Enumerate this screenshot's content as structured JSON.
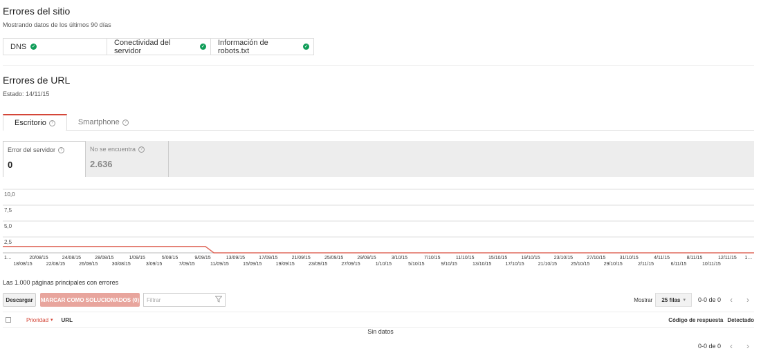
{
  "site_errors": {
    "title": "Errores del sitio",
    "subtitle": "Mostrando datos de los últimos 90 días",
    "checks": [
      {
        "label": "DNS"
      },
      {
        "label": "Conectividad del servidor"
      },
      {
        "label": "Información de robots.txt"
      }
    ],
    "check_color": "#0f9d58"
  },
  "url_errors": {
    "title": "Errores de URL",
    "status": "Estado: 14/11/15",
    "tabs": [
      {
        "label": "Escritorio"
      },
      {
        "label": "Smartphone"
      }
    ],
    "metrics": [
      {
        "label": "Error del servidor",
        "value": "0"
      },
      {
        "label": "No se encuentra",
        "value": "2.636"
      }
    ]
  },
  "chart_data": {
    "type": "line",
    "series_color": "#e06c5f",
    "ylim": [
      0,
      10
    ],
    "y_ticks": [
      "10,0",
      "7,5",
      "5,0",
      "2,5"
    ],
    "x_labels_top": [
      "1…",
      "20/08/15",
      "24/08/15",
      "28/08/15",
      "1/09/15",
      "5/09/15",
      "9/09/15",
      "13/09/15",
      "17/09/15",
      "21/09/15",
      "25/09/15",
      "29/09/15",
      "3/10/15",
      "7/10/15",
      "11/10/15",
      "15/10/15",
      "19/10/15",
      "23/10/15",
      "27/10/15",
      "31/10/15",
      "4/11/15",
      "8/11/15",
      "12/11/15",
      "1…"
    ],
    "x_labels_bottom": [
      "18/08/15",
      "22/08/15",
      "26/08/15",
      "30/08/15",
      "3/09/15",
      "7/09/15",
      "11/09/15",
      "15/09/15",
      "19/09/15",
      "23/09/15",
      "27/09/15",
      "1/10/15",
      "5/10/15",
      "9/10/15",
      "13/10/15",
      "17/10/15",
      "21/10/15",
      "25/10/15",
      "29/10/15",
      "2/11/15",
      "6/11/15",
      "10/11/15"
    ],
    "series": [
      {
        "values": [
          1,
          1,
          1,
          1,
          1,
          1,
          1,
          1,
          1,
          1,
          1,
          1,
          1,
          1,
          1,
          1,
          1,
          1,
          1,
          1,
          1,
          1,
          1,
          1,
          1,
          0,
          0,
          0,
          0,
          0,
          0,
          0,
          0,
          0,
          0,
          0,
          0,
          0,
          0,
          0,
          0,
          0,
          0,
          0,
          0,
          0,
          0,
          0,
          0,
          0,
          0,
          0,
          0,
          0,
          0,
          0,
          0,
          0,
          0,
          0,
          0,
          0,
          0,
          0,
          0,
          0,
          0,
          0,
          0,
          0,
          0,
          0,
          0,
          0,
          0,
          0,
          0,
          0,
          0,
          0,
          0,
          0,
          0,
          0,
          0,
          0,
          0,
          0,
          0,
          0
        ]
      }
    ]
  },
  "table": {
    "title": "Las 1.000 páginas principales con errores",
    "download_label": "Descargar",
    "mark_label": "MARCAR COMO SOLUCIONADOS (0)",
    "filter_placeholder": "Filtrar",
    "show_label": "Mostrar",
    "rows_option": "25 filas",
    "pagination": "0-0 de 0",
    "columns": {
      "priority": "Prioridad",
      "url": "URL",
      "response_code": "Código de respuesta",
      "detected": "Detectado"
    },
    "empty_text": "Sin datos"
  }
}
